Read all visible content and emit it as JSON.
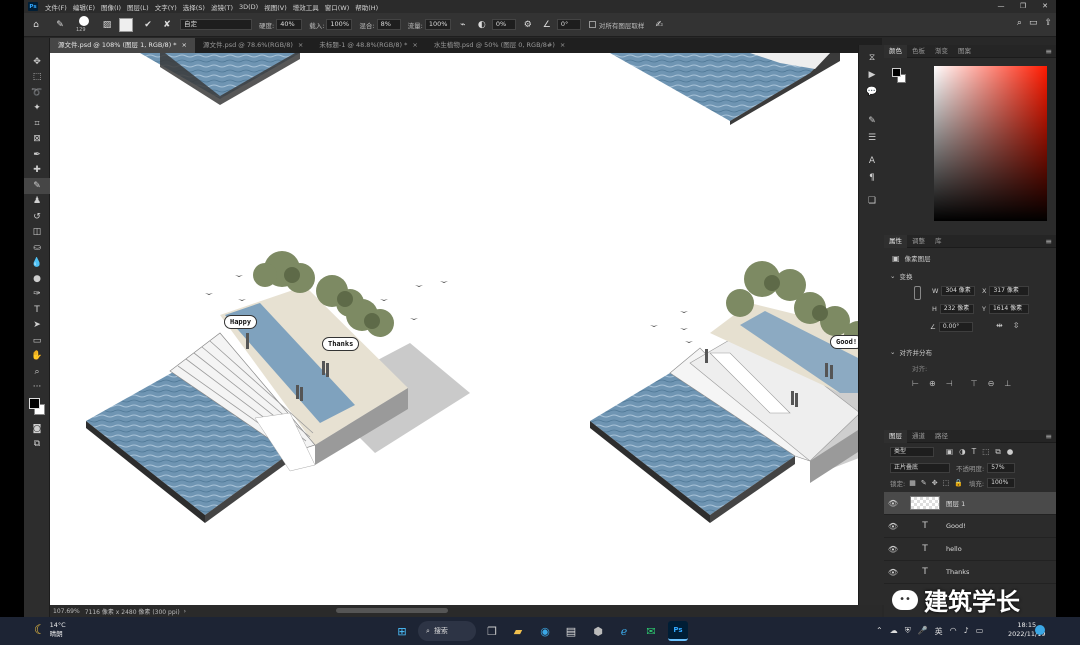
{
  "app": {
    "logo": "Ps"
  },
  "menu": [
    "文件(F)",
    "编辑(E)",
    "图像(I)",
    "图层(L)",
    "文字(Y)",
    "选择(S)",
    "滤镜(T)",
    "3D(D)",
    "视图(V)",
    "增效工具",
    "窗口(W)",
    "帮助(H)"
  ],
  "options": {
    "brush_size": "129",
    "mode_value": "自定",
    "opacity_label": "硬度:",
    "opacity_value": "40%",
    "fade_label": "载入:",
    "fade_value": "100%",
    "mix_label": "混合:",
    "mix_value": "8%",
    "flow_label": "流量:",
    "flow_value": "100%",
    "smooth_value": "0%",
    "angle_value": "0°",
    "sample_all": "对所有图层取样"
  },
  "tabs": [
    {
      "label": "源文件.psd @ 108% (图层 1, RGB/8) *",
      "active": true
    },
    {
      "label": "源文件.psd @ 78.6%(RGB/8)",
      "active": false
    },
    {
      "label": "未标题-1 @ 48.8%(RGB/8) *",
      "active": false
    },
    {
      "label": "水生植物.psd @ 50% (图层 0, RGB/8#)",
      "active": false
    }
  ],
  "canvas": {
    "bubble_happy": "Happy",
    "bubble_thanks": "Thanks",
    "bubble_good": "Good!"
  },
  "status": {
    "zoom": "107.69%",
    "doc": "7116 像素 x 2480 像素 (300 ppi)"
  },
  "color_panel": {
    "tabs": [
      "颜色",
      "色板",
      "渐变",
      "图案"
    ]
  },
  "properties_panel": {
    "tabs": [
      "属性",
      "调整",
      "库"
    ],
    "type_label": "像素图层",
    "transform_label": "变换",
    "w_label": "W",
    "w_value": "304 像素",
    "x_label": "X",
    "x_value": "317 像素",
    "h_label": "H",
    "h_value": "232 像素",
    "y_label": "Y",
    "y_value": "1614 像素",
    "angle_value": "0.00°",
    "align_label": "对齐并分布",
    "align_sub": "对齐:"
  },
  "layers_panel": {
    "tabs": [
      "图层",
      "通道",
      "路径"
    ],
    "filter_value": "类型",
    "blend_mode": "正片叠底",
    "opacity_label": "不透明度:",
    "opacity_value": "57%",
    "lock_label": "锁定:",
    "fill_label": "填充:",
    "fill_value": "100%",
    "layers": [
      {
        "name": "图层 1",
        "kind": "pixel",
        "selected": true
      },
      {
        "name": "Good!",
        "kind": "text",
        "selected": false
      },
      {
        "name": "hello",
        "kind": "text",
        "selected": false
      },
      {
        "name": "Thanks",
        "kind": "text",
        "selected": false
      }
    ]
  },
  "watermark": "建筑学长",
  "taskbar": {
    "weather_temp": "14°C",
    "weather_text": "晴朗",
    "search": "搜索",
    "ime": "英",
    "time": "18:15",
    "date": "2022/11/19"
  }
}
